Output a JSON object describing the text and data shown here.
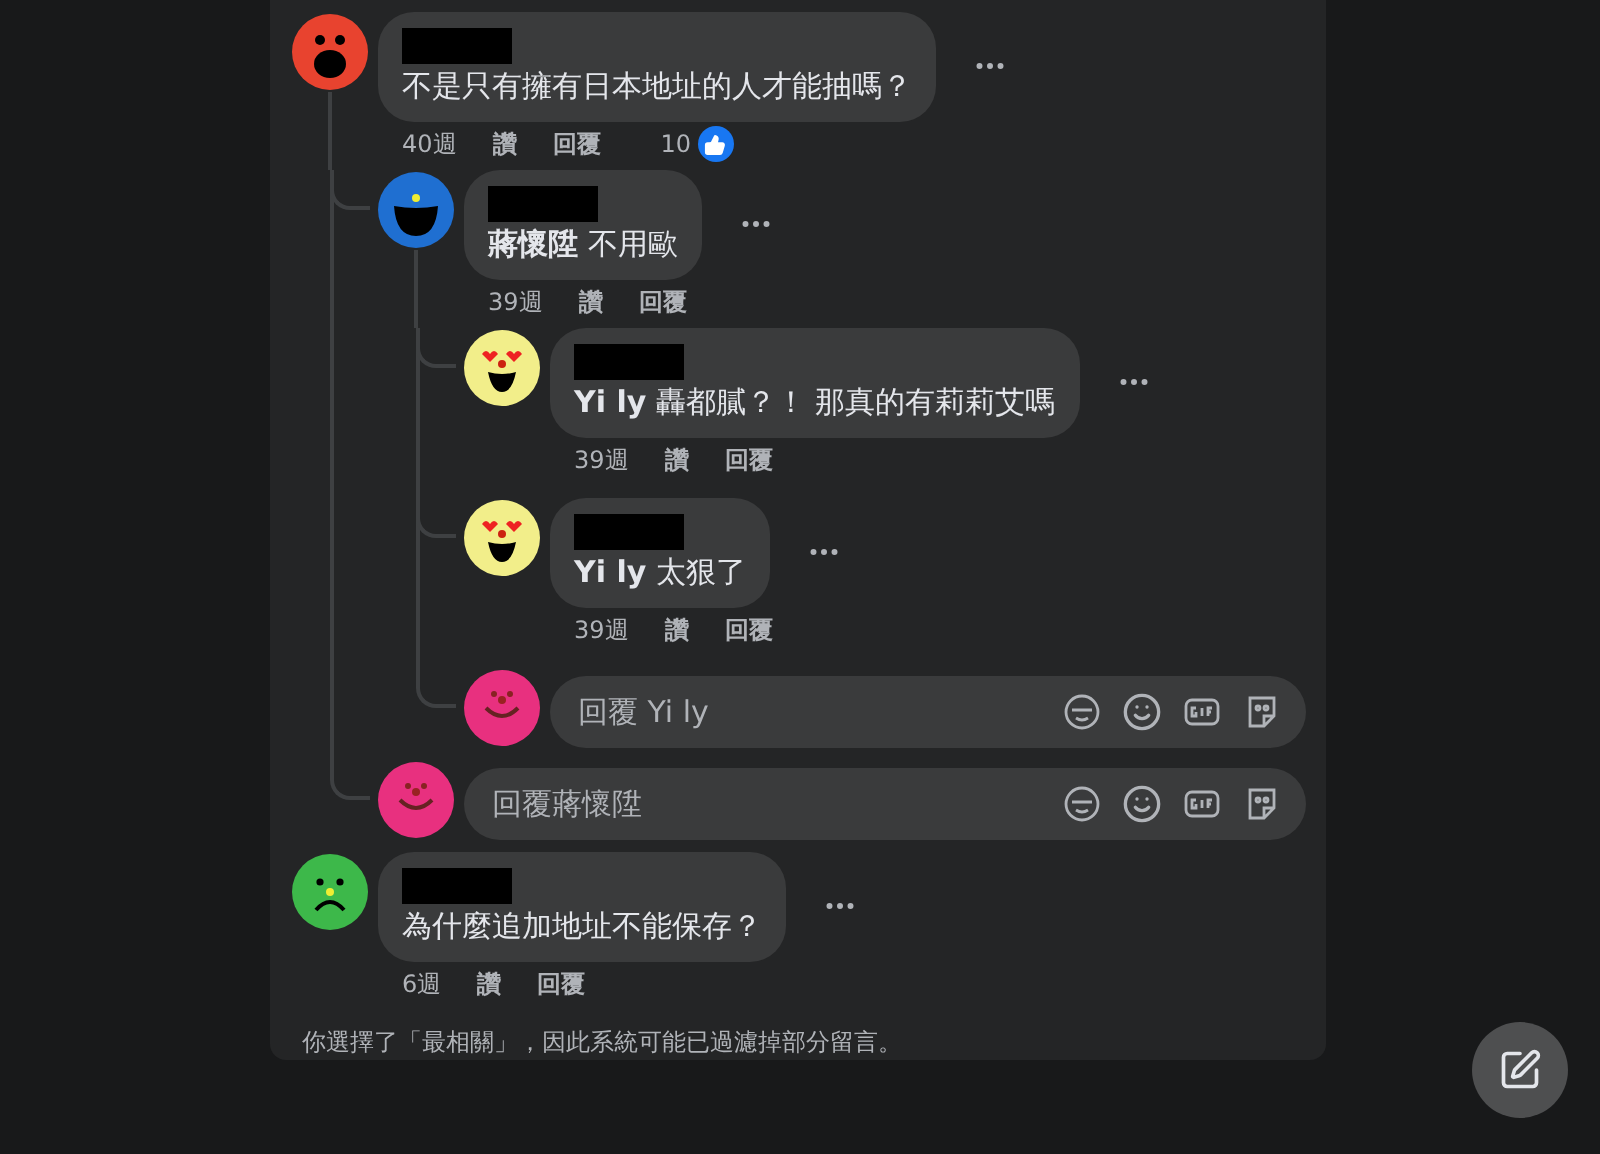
{
  "comments": [
    {
      "kind": "comment",
      "avatar": {
        "kind": "surprised",
        "color": "#e8432f"
      },
      "text": "不是只有擁有日本地址的人才能抽嗎？",
      "meta": [
        "40週",
        "讚",
        "回覆"
      ],
      "reactions": "10",
      "children": [
        {
          "kind": "comment",
          "avatar": {
            "kind": "grin",
            "color": "#1f6fd1"
          },
          "text": "**蔣懷陞** 不用歐",
          "meta": [
            "39週",
            "讚",
            "回覆"
          ],
          "children": [
            {
              "kind": "comment",
              "avatar": {
                "kind": "hearts",
                "color": "#f2ee8a"
              },
              "text": "**Yi ly** 轟都膩？！ 那真的有莉莉艾嗎",
              "meta": [
                "39週",
                "讚",
                "回覆"
              ]
            },
            {
              "kind": "comment",
              "avatar": {
                "kind": "hearts",
                "color": "#f2ee8a"
              },
              "text": "**Yi ly** 太狠了",
              "meta": [
                "39週",
                "讚",
                "回覆"
              ]
            },
            {
              "kind": "reply_box",
              "avatar": {
                "kind": "smile",
                "color": "#e8307f"
              },
              "placeholder": "回覆 Yi ly"
            }
          ]
        },
        {
          "kind": "reply_box",
          "avatar": {
            "kind": "smile",
            "color": "#e8307f"
          },
          "placeholder": "回覆蔣懷陞"
        }
      ]
    },
    {
      "kind": "comment",
      "avatar": {
        "kind": "sad",
        "color": "#3db84a"
      },
      "text": "為什麼追加地址不能保存？",
      "meta": [
        "6週",
        "讚",
        "回覆"
      ]
    }
  ],
  "footer_note": "你選擇了「最相關」，因此系統可能已過濾掉部分留言。"
}
